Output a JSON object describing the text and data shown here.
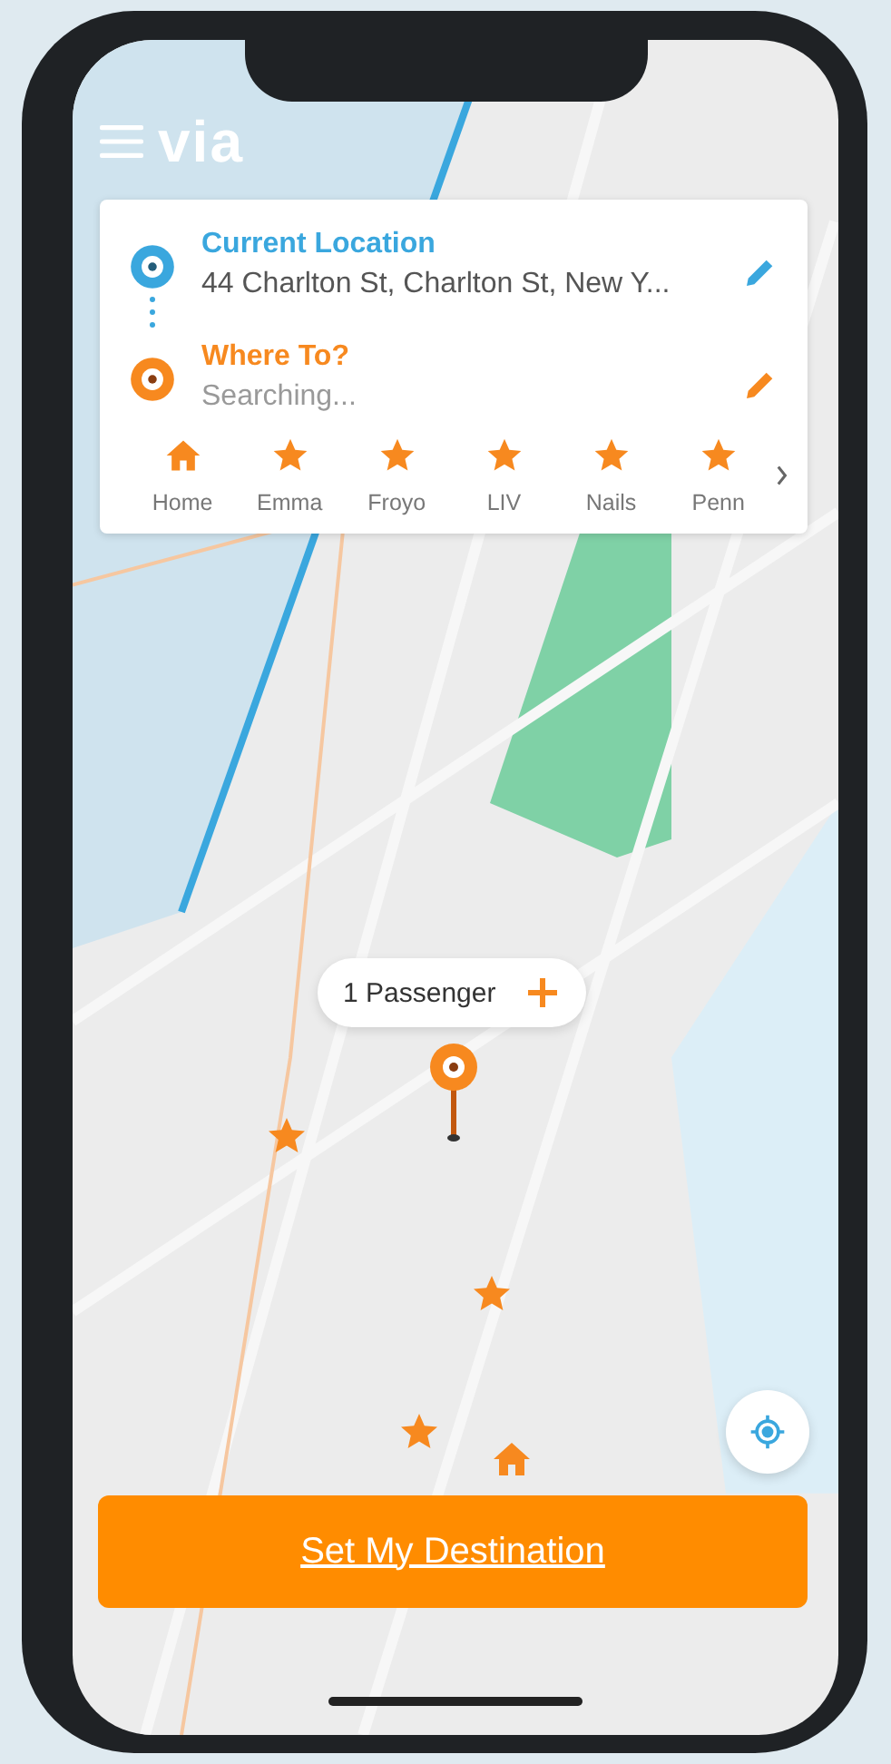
{
  "header": {
    "logo": "via"
  },
  "route": [
    {
      "kind": "origin",
      "title": "Current Location",
      "value": "44 Charlton St, Charlton St, New Y..."
    },
    {
      "kind": "destination",
      "title": "Where To?",
      "value": "Searching..."
    }
  ],
  "favorites": [
    {
      "kind": "home",
      "label": "Home"
    },
    {
      "kind": "star",
      "label": "Emma"
    },
    {
      "kind": "star",
      "label": "Froyo"
    },
    {
      "kind": "star",
      "label": "LIV"
    },
    {
      "kind": "star",
      "label": "Nails"
    },
    {
      "kind": "star",
      "label": "Penn"
    }
  ],
  "passengers": {
    "label": "1 Passenger"
  },
  "map_pins": [
    {
      "kind": "star"
    },
    {
      "kind": "star"
    },
    {
      "kind": "star"
    },
    {
      "kind": "home"
    }
  ],
  "primary_button": {
    "label": "Set My Destination"
  }
}
